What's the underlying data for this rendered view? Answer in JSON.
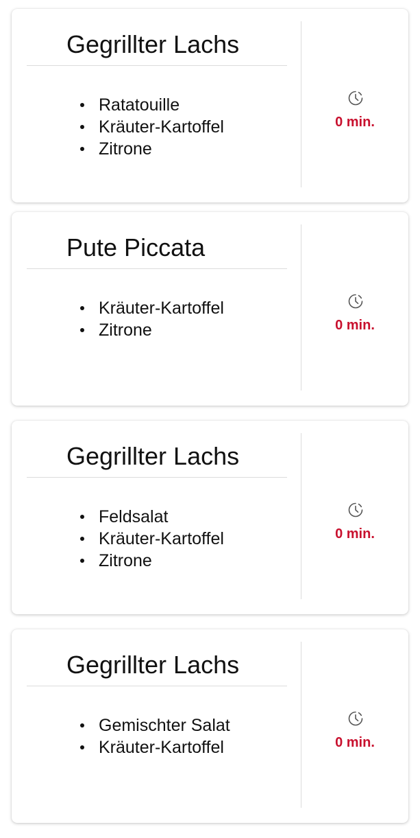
{
  "orders": [
    {
      "title": "Gegrillter Lachs",
      "items": [
        "Ratatouille",
        "Kräuter-Kartoffel",
        "Zitrone"
      ],
      "duration": "0 min.",
      "icon": "clock-icon"
    },
    {
      "title": "Pute Piccata",
      "items": [
        "Kräuter-Kartoffel",
        "Zitrone"
      ],
      "duration": "0 min.",
      "icon": "clock-icon"
    },
    {
      "title": "Gegrillter Lachs",
      "items": [
        "Feldsalat",
        "Kräuter-Kartoffel",
        "Zitrone"
      ],
      "duration": "0 min.",
      "icon": "clock-icon"
    },
    {
      "title": "Gegrillter Lachs",
      "items": [
        "Gemischter Salat",
        "Kräuter-Kartoffel"
      ],
      "duration": "0 min.",
      "icon": "clock-icon"
    }
  ],
  "colors": {
    "duration": "#c8102e",
    "text": "#111111",
    "divider": "#dcdcdc"
  }
}
